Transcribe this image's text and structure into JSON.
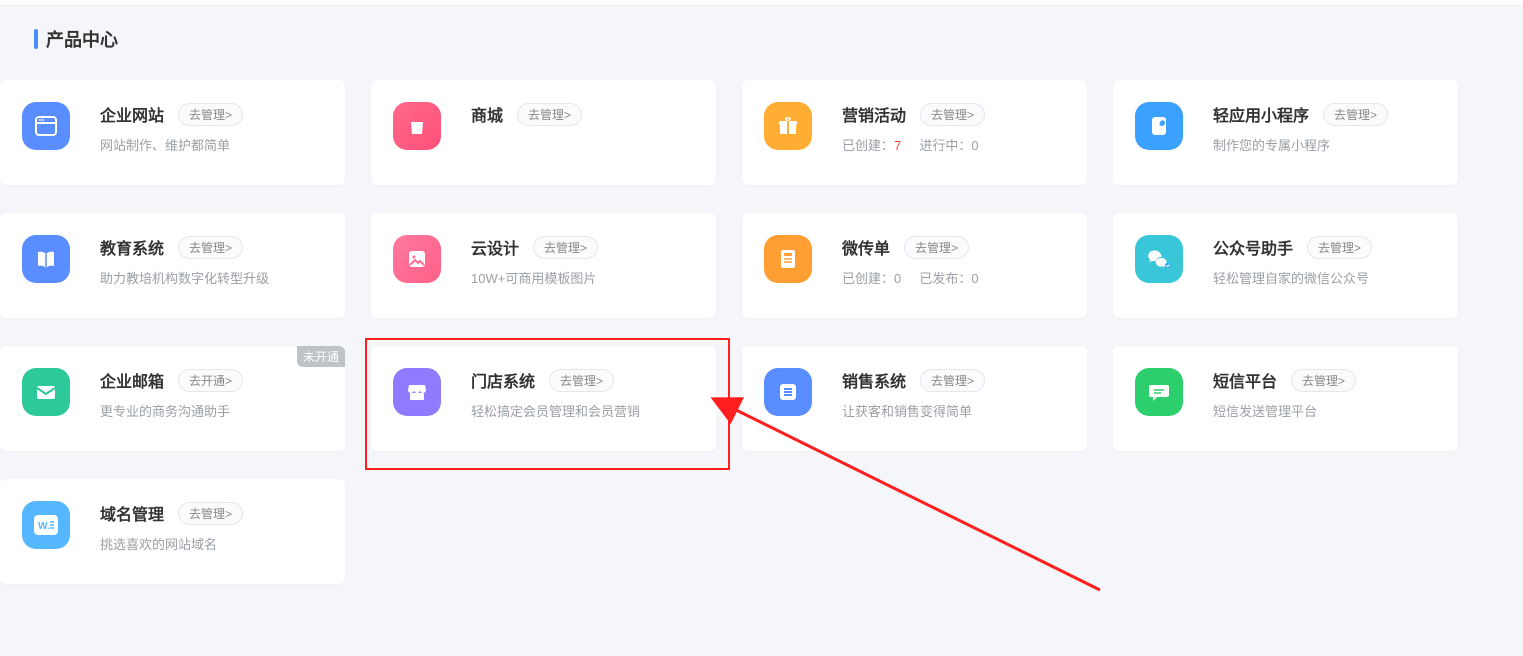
{
  "section_title": "产品中心",
  "manage_label": "去管理>",
  "activate_label": "去开通>",
  "unopened_label": "未开通",
  "cards": {
    "enterprise_site": {
      "title": "企业网站",
      "desc": "网站制作、维护都简单"
    },
    "mall": {
      "title": "商城"
    },
    "marketing": {
      "title": "营销活动",
      "stat1_label": "已创建：",
      "stat1_value": "7",
      "stat2_label": "进行中：",
      "stat2_value": "0"
    },
    "miniprogram": {
      "title": "轻应用小程序",
      "desc": "制作您的专属小程序"
    },
    "edu": {
      "title": "教育系统",
      "desc": "助力教培机构数字化转型升级"
    },
    "clouddesign": {
      "title": "云设计",
      "desc": "10W+可商用模板图片"
    },
    "leaflet": {
      "title": "微传单",
      "stat1_label": "已创建：",
      "stat1_value": "0",
      "stat2_label": "已发布：",
      "stat2_value": "0"
    },
    "wechat": {
      "title": "公众号助手",
      "desc": "轻松管理自家的微信公众号"
    },
    "mail": {
      "title": "企业邮箱",
      "desc": "更专业的商务沟通助手"
    },
    "store": {
      "title": "门店系统",
      "desc": "轻松搞定会员管理和会员营销"
    },
    "sales": {
      "title": "销售系统",
      "desc": "让获客和销售变得简单"
    },
    "sms": {
      "title": "短信平台",
      "desc": "短信发送管理平台"
    },
    "domain": {
      "title": "域名管理",
      "desc": "挑选喜欢的网站域名"
    }
  }
}
